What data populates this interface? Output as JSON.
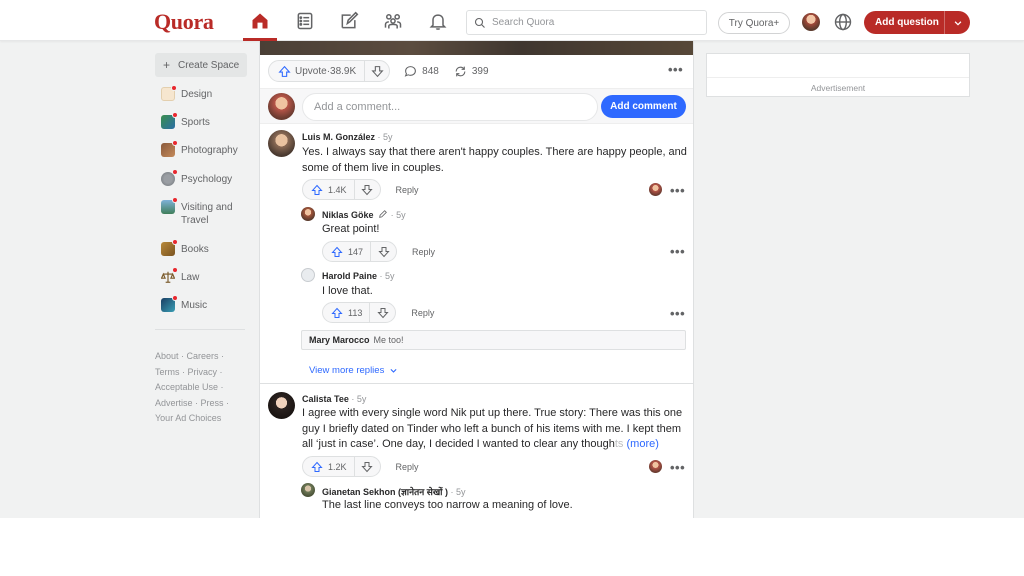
{
  "header": {
    "logo": "Quora",
    "search_placeholder": "Search Quora",
    "try_plus": "Try Quora+",
    "add_question": "Add question",
    "colors": {
      "brand": "#b92b27",
      "link": "#2e69ff"
    }
  },
  "sidebar": {
    "create_space": "Create Space",
    "items": [
      {
        "label": "Design"
      },
      {
        "label": "Sports"
      },
      {
        "label": "Photography"
      },
      {
        "label": "Psychology"
      },
      {
        "label": "Visiting and Travel"
      },
      {
        "label": "Books"
      },
      {
        "label": "Law"
      },
      {
        "label": "Music"
      }
    ],
    "footer": {
      "about": "About",
      "careers": "Careers",
      "terms": "Terms",
      "privacy": "Privacy",
      "acceptable_use": "Acceptable Use",
      "advertise": "Advertise",
      "press": "Press",
      "ad_choices": "Your Ad Choices",
      "sep": " · "
    }
  },
  "answer": {
    "upvote_label": "Upvote",
    "upvote_count": "38.9K",
    "comments": "848",
    "shares": "399",
    "dot_sep": " · "
  },
  "comment_box": {
    "placeholder": "Add a comment...",
    "button": "Add comment"
  },
  "comments": [
    {
      "author": "Luis M. González",
      "age": "5y",
      "text": "Yes. I always say that there aren't happy couples. There are happy people, and some of them live in couples.",
      "upvotes": "1.4K",
      "reply": "Reply",
      "replies": [
        {
          "author": "Niklas Göke",
          "age": "5y",
          "text": "Great point!",
          "upvotes": "147",
          "reply": "Reply"
        },
        {
          "author": "Harold Paine",
          "age": "5y",
          "text": "I love that.",
          "upvotes": "113",
          "reply": "Reply"
        }
      ],
      "collapsed_reply": {
        "author": "Mary Marocco",
        "text": "Me too!"
      },
      "view_more": "View more replies"
    },
    {
      "author": "Calista Tee",
      "age": "5y",
      "text": "I agree with every single word Nik put up there. True story: There was this one guy I briefly dated on Tinder who left a bunch of his items with me. I kept them all ‘just in case’. One day, I decided I wanted to clear any though",
      "fade_text": "ts",
      "more": "(more)",
      "upvotes": "1.2K",
      "reply": "Reply",
      "replies": [
        {
          "author": "Gianetan Sekhon (ज्ञानेतन सेखों )",
          "age": "5y",
          "text": "The last line conveys too narrow a meaning of love."
        }
      ]
    }
  ],
  "ad": {
    "label": "Advertisement"
  }
}
